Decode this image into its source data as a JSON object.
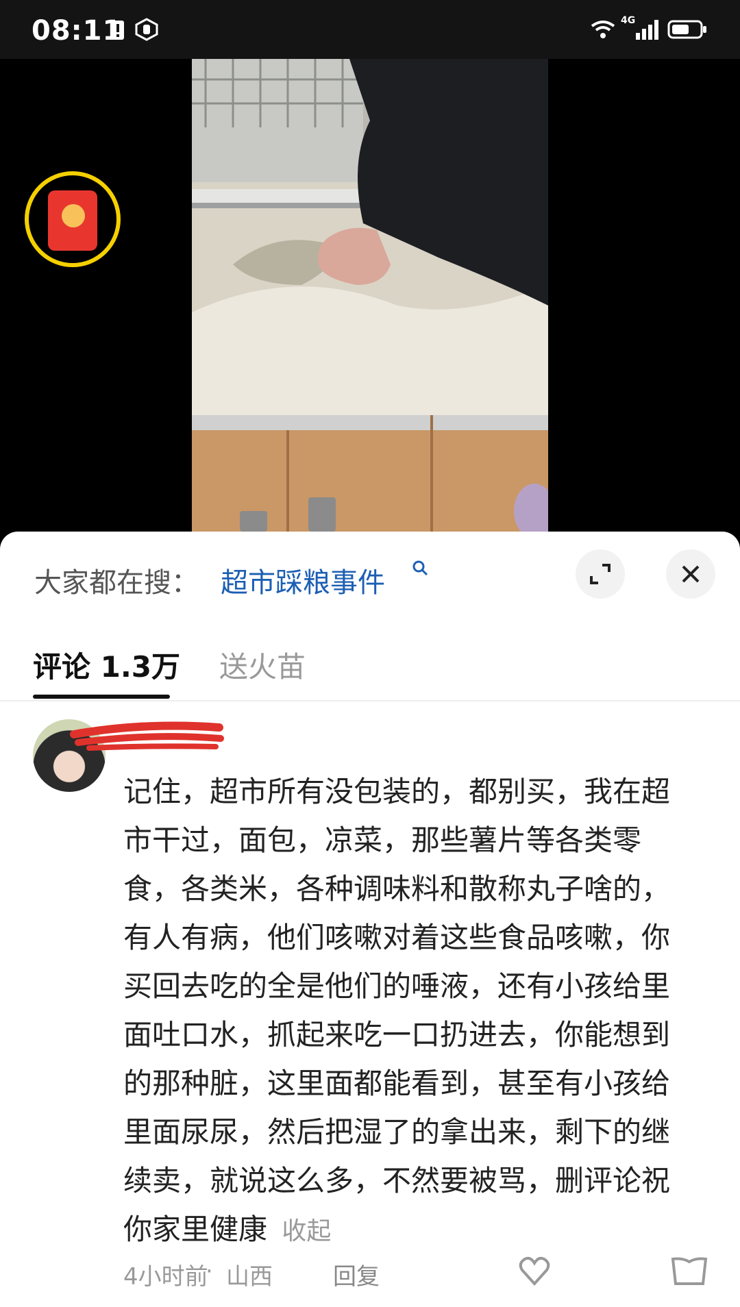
{
  "status_bar": {
    "time": "08:11",
    "network": "4G"
  },
  "search_bar": {
    "prefix": "大家都在搜：",
    "term": "超市踩粮事件",
    "expand_icon": "expand-icon",
    "close_icon": "close-icon"
  },
  "tabs": [
    {
      "label": "评论 1.3万",
      "active": true
    },
    {
      "label": "送火苗",
      "active": false
    }
  ],
  "comment": {
    "text": "记住，超市所有没包装的，都别买，我在超市干过，面包，凉菜，那些薯片等各类零食，各类米，各种调味料和散称丸子啥的，有人有病，他们咳嗽对着这些食品咳嗽，你买回去吃的全是他们的唾液，还有小孩给里面吐口水，抓起来吃一口扔进去，你能想到的那种脏，这里面都能看到，甚至有小孩给里面尿尿，然后把湿了的拿出来，剩下的继续卖，就说这么多，不然要被骂，删评论祝你家里健康",
    "collapse_label": "收起",
    "time_ago": "4小时前",
    "location": "山西",
    "reply_label": "回复"
  },
  "colors": {
    "accent_link": "#1c5fb3",
    "packet_red": "#e8362f",
    "ring_yellow": "#f5d000"
  }
}
